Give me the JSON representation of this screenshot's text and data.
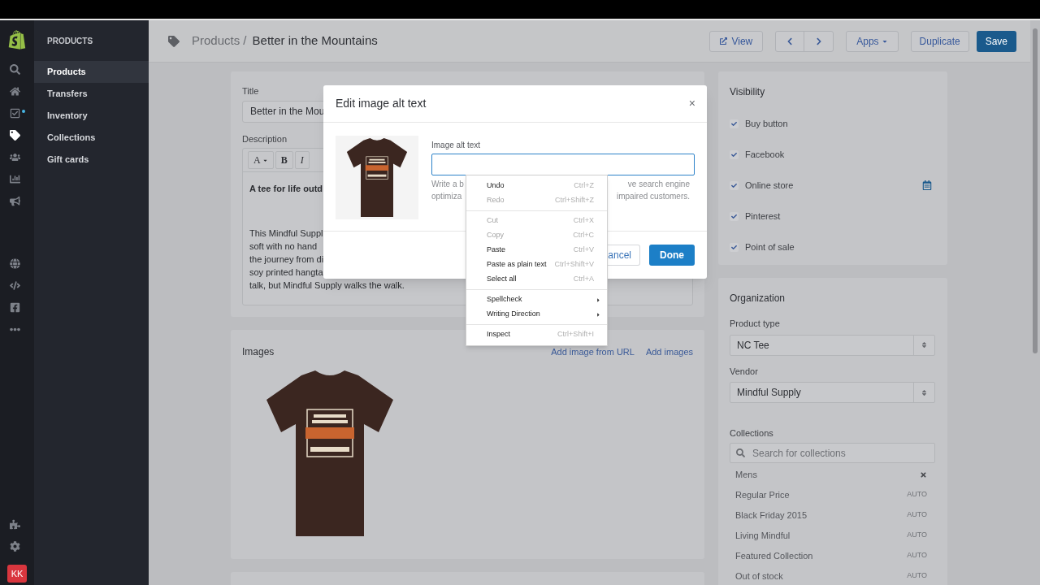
{
  "rail": {
    "items": [
      {
        "selected": false,
        "dot": false
      },
      {
        "selected": false,
        "dot": false
      },
      {
        "selected": false,
        "dot": true
      },
      {
        "selected": true,
        "dot": false
      },
      {
        "selected": false,
        "dot": false
      },
      {
        "selected": false,
        "dot": false
      },
      {
        "selected": false,
        "dot": false
      },
      {
        "selected": false,
        "dot": false
      },
      {
        "selected": false,
        "dot": false
      },
      {
        "selected": false,
        "dot": false
      },
      {
        "selected": false,
        "dot": false
      },
      {
        "selected": false,
        "dot": false
      },
      {
        "selected": false,
        "dot": false
      }
    ],
    "avatar": "KK"
  },
  "nav": {
    "heading": "PRODUCTS",
    "items": [
      {
        "label": "Products",
        "selected": true
      },
      {
        "label": "Transfers",
        "selected": false
      },
      {
        "label": "Inventory",
        "selected": false
      },
      {
        "label": "Collections",
        "selected": false
      },
      {
        "label": "Gift cards",
        "selected": false
      }
    ]
  },
  "topbar": {
    "breadcrumb": "Products /",
    "title": "Better in the Mountains",
    "view_button": "View",
    "apps_button": "Apps",
    "duplicate_button": "Duplicate",
    "save_button": "Save"
  },
  "product": {
    "title_label": "Title",
    "title_value": "Better in the Mou",
    "description_label": "Description",
    "toolbar": [
      "A",
      "B",
      "I"
    ],
    "paragraphs": [
      {
        "bold": true,
        "lines": [
          "A tee for life outd"
        ]
      },
      {
        "bold": false,
        "lines": [
          "This Mindful Suppl",
          "soft with no hand",
          "the journey from di",
          "soy printed hangta",
          "talk, but Mindful Supply walks the walk."
        ]
      }
    ]
  },
  "images": {
    "title": "Images",
    "links": [
      "Add image from URL",
      "Add images"
    ]
  },
  "visibility": {
    "title": "Visibility",
    "channels": [
      {
        "label": "Buy button",
        "checked": true,
        "calendar": false
      },
      {
        "label": "Facebook",
        "checked": true,
        "calendar": false
      },
      {
        "label": "Online store",
        "checked": true,
        "calendar": true
      },
      {
        "label": "Pinterest",
        "checked": true,
        "calendar": false
      },
      {
        "label": "Point of sale",
        "checked": true,
        "calendar": false
      }
    ]
  },
  "organization": {
    "title": "Organization",
    "product_type_label": "Product type",
    "product_type": "NC Tee",
    "vendor_label": "Vendor",
    "vendor": "Mindful Supply",
    "collections_label": "Collections",
    "collections_placeholder": "Search for collections",
    "collections": [
      {
        "name": "Mens",
        "kind": "manual"
      },
      {
        "name": "Regular Price",
        "kind": "auto",
        "tag": "AUTO"
      },
      {
        "name": "Black Friday 2015",
        "kind": "auto",
        "tag": "AUTO"
      },
      {
        "name": "Living Mindful",
        "kind": "auto",
        "tag": "AUTO"
      },
      {
        "name": "Featured Collection",
        "kind": "auto",
        "tag": "AUTO"
      },
      {
        "name": "Out of stock",
        "kind": "auto",
        "tag": "AUTO"
      }
    ]
  },
  "modal": {
    "title": "Edit image alt text",
    "close": "×",
    "field_label": "Image alt text",
    "help_left": [
      "Write a b",
      "optimiza"
    ],
    "help_right": [
      "ve search engine",
      "impaired customers."
    ],
    "cancel": "ancel",
    "done": "Done"
  },
  "context_menu": {
    "groups": [
      [
        {
          "label": "Undo",
          "shortcut": "Ctrl+Z",
          "kind": "item",
          "disabled": false
        },
        {
          "label": "Redo",
          "shortcut": "Ctrl+Shift+Z",
          "kind": "item",
          "disabled": true
        }
      ],
      [
        {
          "label": "Cut",
          "shortcut": "Ctrl+X",
          "kind": "item",
          "disabled": true
        },
        {
          "label": "Copy",
          "shortcut": "Ctrl+C",
          "kind": "item",
          "disabled": true
        },
        {
          "label": "Paste",
          "shortcut": "Ctrl+V",
          "kind": "item",
          "disabled": false
        },
        {
          "label": "Paste as plain text",
          "shortcut": "Ctrl+Shift+V",
          "kind": "item",
          "disabled": false
        },
        {
          "label": "Select all",
          "shortcut": "Ctrl+A",
          "kind": "item",
          "disabled": false
        }
      ],
      [
        {
          "label": "Spellcheck",
          "kind": "submenu",
          "disabled": false
        },
        {
          "label": "Writing Direction",
          "kind": "submenu",
          "disabled": false
        }
      ],
      [
        {
          "label": "Inspect",
          "shortcut": "Ctrl+Shift+I",
          "kind": "item",
          "disabled": false
        }
      ]
    ]
  }
}
